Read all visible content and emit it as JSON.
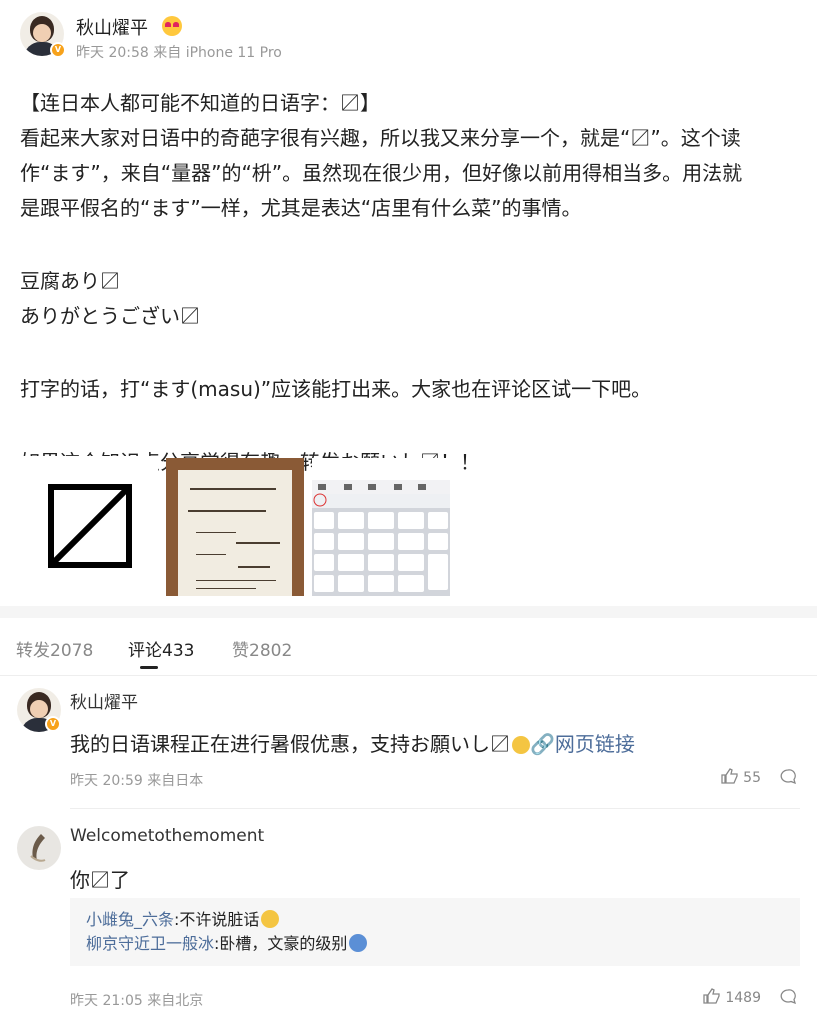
{
  "post": {
    "author": "秋山燿平",
    "meta": "昨天 20:58 来自 iPhone 11 Pro",
    "lines": [
      "【连日本人都可能不知道的日语字：〼】",
      "看起来大家对日语中的奇葩字很有兴趣，所以我又来分享一个，就是“〼”。这个读",
      "作“ます”，来自“量器”的“枡”。虽然现在很少用，但好像以前用得相当多。用法就",
      "是跟平假名的“ます”一样，尤其是表达“店里有什么菜”的事情。",
      "豆腐あり〼",
      "ありがとうござい〼",
      "打字的话，打“ます(masu)”应该能打出来。大家也在评论区试一下吧。",
      "如果这个知识点分享觉得有趣，转发お願いし〼！！"
    ],
    "images": {
      "image1_icon": "masu-symbol",
      "image2_icon": "shop-sign-photo",
      "image3_icon": "keyboard-screenshot"
    }
  },
  "tabs": {
    "repost": "转发2078",
    "comments": "评论433",
    "likes": "赞2802"
  },
  "comments": [
    {
      "name": "秋山燿平",
      "text": "我的日语课程正在进行暑假优惠，支持お願いし〼",
      "link": "网页链接",
      "meta": "昨天 20:59 来自日本",
      "likes": "55"
    },
    {
      "name": "Welcometothemoment",
      "text": "你〼了",
      "meta": "昨天 21:05 来自北京",
      "likes": "1489",
      "replies": [
        {
          "user": "小雌兔_六条",
          "text": ":不许说脏话"
        },
        {
          "user": "柳京守近卫一般冰",
          "text": ":卧槽，文豪的级别"
        }
      ]
    }
  ],
  "colors": {
    "link": "#4d6d9a",
    "verified_badge": "#f7a21b",
    "meta_gray": "#999999"
  }
}
